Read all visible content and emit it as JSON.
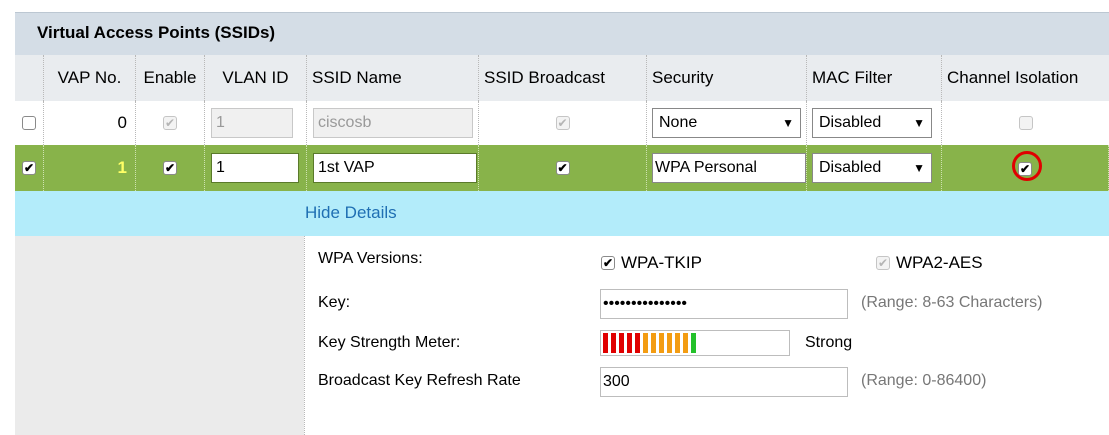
{
  "section_title": "Virtual Access Points (SSIDs)",
  "columns": {
    "vap_no": "VAP No.",
    "enable": "Enable",
    "vlan_id": "VLAN ID",
    "ssid_name": "SSID Name",
    "ssid_broadcast": "SSID Broadcast",
    "security": "Security",
    "mac_filter": "MAC Filter",
    "channel_isolation": "Channel Isolation"
  },
  "rows": [
    {
      "selected": false,
      "vap_no": "0",
      "enable": true,
      "vlan_id": "1",
      "ssid_name": "ciscosb",
      "ssid_broadcast": true,
      "security": "None",
      "mac_filter": "Disabled",
      "channel_isolation": false
    },
    {
      "selected": true,
      "vap_no": "1",
      "enable": true,
      "vlan_id": "1",
      "ssid_name": "1st VAP",
      "ssid_broadcast": true,
      "security": "WPA Personal",
      "mac_filter": "Disabled",
      "channel_isolation": true
    }
  ],
  "details_link": "Hide Details",
  "details": {
    "wpa_versions_label": "WPA Versions:",
    "wpa_tkip_label": "WPA-TKIP",
    "wpa2_aes_label": "WPA2-AES",
    "key_label": "Key:",
    "key_value": "•••••••••••••••",
    "key_hint": "(Range: 8-63 Characters)",
    "strength_label": "Key Strength Meter:",
    "strength_text": "Strong",
    "refresh_label": "Broadcast Key Refresh Rate",
    "refresh_value": "300",
    "refresh_hint": "(Range: 0-86400)"
  },
  "colors": {
    "selected_row": "#88b34a",
    "details_bar": "#b3ecfa",
    "highlight_circle": "#e00000"
  }
}
